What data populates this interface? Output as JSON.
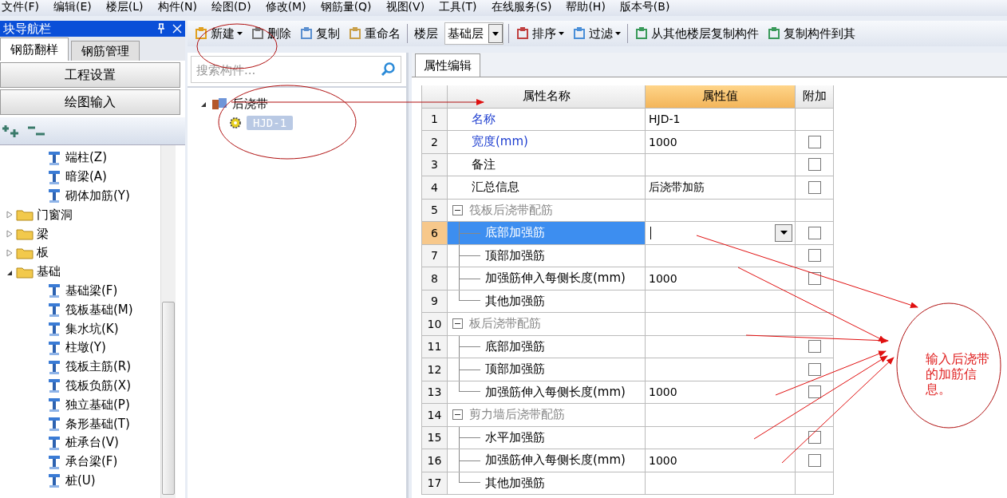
{
  "menu": [
    "文件(F)",
    "编辑(E)",
    "楼层(L)",
    "构件(N)",
    "绘图(D)",
    "修改(M)",
    "钢筋量(Q)",
    "视图(V)",
    "工具(T)",
    "在线服务(S)",
    "帮助(H)",
    "版本号(B)"
  ],
  "nav_panel": {
    "title": "块导航栏",
    "tabs": [
      {
        "label": "钢筋翻样",
        "selected": true
      },
      {
        "label": "钢筋管理",
        "selected": false
      }
    ],
    "sections": [
      "工程设置",
      "绘图输入"
    ],
    "tree": [
      {
        "label": "端柱(Z)",
        "kind": "leaf"
      },
      {
        "label": "暗梁(A)",
        "kind": "leaf"
      },
      {
        "label": "砌体加筋(Y)",
        "kind": "leaf"
      },
      {
        "label": "门窗洞",
        "kind": "folder",
        "expanded": false
      },
      {
        "label": "梁",
        "kind": "folder",
        "expanded": false
      },
      {
        "label": "板",
        "kind": "folder",
        "expanded": false
      },
      {
        "label": "基础",
        "kind": "folder",
        "expanded": true,
        "children": [
          {
            "label": "基础梁(F)",
            "kind": "leaf"
          },
          {
            "label": "筏板基础(M)",
            "kind": "leaf"
          },
          {
            "label": "集水坑(K)",
            "kind": "leaf"
          },
          {
            "label": "柱墩(Y)",
            "kind": "leaf"
          },
          {
            "label": "筏板主筋(R)",
            "kind": "leaf"
          },
          {
            "label": "筏板负筋(X)",
            "kind": "leaf"
          },
          {
            "label": "独立基础(P)",
            "kind": "leaf"
          },
          {
            "label": "条形基础(T)",
            "kind": "leaf"
          },
          {
            "label": "桩承台(V)",
            "kind": "leaf"
          },
          {
            "label": "承台梁(F)",
            "kind": "leaf"
          },
          {
            "label": "桩(U)",
            "kind": "leaf"
          }
        ]
      }
    ]
  },
  "toolbar": {
    "items": [
      {
        "kind": "button",
        "label": "新建",
        "dropdown": true
      },
      {
        "kind": "button",
        "label": "删除",
        "dropdown": false
      },
      {
        "kind": "button",
        "label": "复制",
        "dropdown": false
      },
      {
        "kind": "button",
        "label": "重命名",
        "dropdown": false
      },
      {
        "kind": "floor",
        "label": "楼层",
        "value": "基础层"
      },
      {
        "kind": "button",
        "label": "排序",
        "dropdown": true
      },
      {
        "kind": "button",
        "label": "过滤",
        "dropdown": true
      },
      {
        "kind": "button",
        "label": "从其他楼层复制构件",
        "dropdown": false
      },
      {
        "kind": "button",
        "label": "复制构件到其",
        "dropdown": false
      }
    ]
  },
  "component_list": {
    "search": {
      "placeholder": "搜索构件..."
    },
    "tree": [
      {
        "label": "后浇带",
        "expanded": true,
        "children": [
          {
            "label": "HJD-1",
            "selected": true
          }
        ]
      }
    ]
  },
  "properties": {
    "tab": "属性编辑",
    "columns": [
      "属性名称",
      "属性值",
      "附加"
    ],
    "rows": [
      {
        "num": "1",
        "name": "名称",
        "value": "HJD-1",
        "kind": "prop",
        "required": true
      },
      {
        "num": "2",
        "name": "宽度(mm)",
        "value": "1000",
        "kind": "prop",
        "required": true,
        "checkbox": {
          "checked": false
        }
      },
      {
        "num": "3",
        "name": "备注",
        "kind": "prop",
        "required": false,
        "checkbox": {
          "checked": false
        }
      },
      {
        "num": "4",
        "name": "汇总信息",
        "value": "后浇带加筋",
        "kind": "prop",
        "required": false,
        "checkbox": {
          "checked": false
        }
      },
      {
        "num": "5",
        "name": "筏板后浇带配筋",
        "kind": "group",
        "expanded": true,
        "children": [
          {
            "num": "6",
            "name": "底部加强筋",
            "kind": "prop",
            "selected": true,
            "editing": true,
            "checkbox": {
              "checked": false
            }
          },
          {
            "num": "7",
            "name": "顶部加强筋",
            "kind": "prop",
            "selected": false,
            "checkbox": {
              "checked": false
            }
          },
          {
            "num": "8",
            "name": "加强筋伸入每侧长度(mm)",
            "value": "1000",
            "kind": "prop",
            "selected": false,
            "checkbox": {
              "checked": false
            }
          },
          {
            "num": "9",
            "name": "其他加强筋",
            "kind": "prop",
            "selected": false
          }
        ]
      },
      {
        "num": "10",
        "name": "板后浇带配筋",
        "kind": "group",
        "expanded": true,
        "children": [
          {
            "num": "11",
            "name": "底部加强筋",
            "kind": "prop",
            "selected": false,
            "checkbox": {
              "checked": false
            }
          },
          {
            "num": "12",
            "name": "顶部加强筋",
            "kind": "prop",
            "selected": false,
            "checkbox": {
              "checked": false
            }
          },
          {
            "num": "13",
            "name": "加强筋伸入每侧长度(mm)",
            "value": "1000",
            "kind": "prop",
            "selected": false,
            "checkbox": {
              "checked": false
            }
          }
        ]
      },
      {
        "num": "14",
        "name": "剪力墙后浇带配筋",
        "kind": "group",
        "expanded": true,
        "children": [
          {
            "num": "15",
            "name": "水平加强筋",
            "kind": "prop",
            "selected": false,
            "checkbox": {
              "checked": false
            }
          },
          {
            "num": "16",
            "name": "加强筋伸入每侧长度(mm)",
            "value": "1000",
            "kind": "prop",
            "selected": false,
            "checkbox": {
              "checked": false
            }
          },
          {
            "num": "17",
            "name": "其他加强筋",
            "kind": "prop",
            "selected": false
          }
        ]
      }
    ]
  },
  "annotation": {
    "note": "输入后浇带的加筋信息。"
  }
}
